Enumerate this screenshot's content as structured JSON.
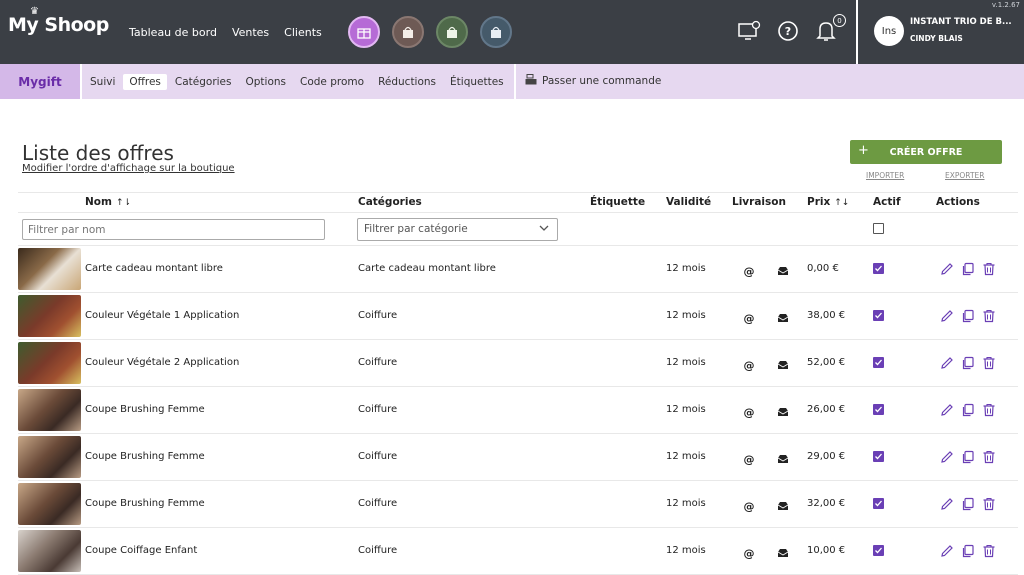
{
  "app": {
    "logo": "My Shoop",
    "version": "v.1.2.67"
  },
  "topnav": [
    {
      "label": "Tableau de bord"
    },
    {
      "label": "Ventes"
    },
    {
      "label": "Clients"
    }
  ],
  "apps": [
    {
      "name": "gift-app-icon",
      "color": "#b66bd6"
    },
    {
      "name": "shop-app-icon-1",
      "color": "#6e5a55"
    },
    {
      "name": "shop-app-icon-2",
      "color": "#4f6a4a"
    },
    {
      "name": "shop-app-icon-3",
      "color": "#455a6a"
    }
  ],
  "user": {
    "avatar": "Ins",
    "shop": "INSTANT TRIO DE B...",
    "name": "CINDY BLAIS",
    "notifications": "0"
  },
  "subnav": {
    "brand": "Mygift",
    "items": [
      {
        "label": "Suivi"
      },
      {
        "label": "Offres"
      },
      {
        "label": "Catégories"
      },
      {
        "label": "Options"
      },
      {
        "label": "Code promo"
      },
      {
        "label": "Réductions"
      },
      {
        "label": "Étiquettes"
      }
    ],
    "order": "Passer une commande"
  },
  "page": {
    "title": "Liste des offres",
    "reorder_link": "Modifier l'ordre d'affichage sur la boutique",
    "create_button": "CRÉER OFFRE",
    "import": "IMPORTER",
    "export": "EXPORTER"
  },
  "table": {
    "headers": {
      "name": "Nom",
      "categories": "Catégories",
      "label": "Étiquette",
      "validity": "Validité",
      "delivery": "Livraison",
      "price": "Prix",
      "active": "Actif",
      "actions": "Actions"
    },
    "filters": {
      "name_placeholder": "Filtrer par nom",
      "category_placeholder": "Filtrer par catégorie"
    },
    "rows": [
      {
        "name": "Carte cadeau montant libre",
        "category": "Carte cadeau montant libre",
        "validity": "12 mois",
        "price": "0,00 €",
        "active": true
      },
      {
        "name": "Couleur Végétale 1 Application",
        "category": "Coiffure",
        "validity": "12 mois",
        "price": "38,00 €",
        "active": true
      },
      {
        "name": "Couleur Végétale 2 Application",
        "category": "Coiffure",
        "validity": "12 mois",
        "price": "52,00 €",
        "active": true
      },
      {
        "name": "Coupe Brushing Femme",
        "category": "Coiffure",
        "validity": "12 mois",
        "price": "26,00 €",
        "active": true
      },
      {
        "name": "Coupe Brushing Femme",
        "category": "Coiffure",
        "validity": "12 mois",
        "price": "29,00 €",
        "active": true
      },
      {
        "name": "Coupe Brushing Femme",
        "category": "Coiffure",
        "validity": "12 mois",
        "price": "32,00 €",
        "active": true
      },
      {
        "name": "Coupe Coiffage Enfant",
        "category": "Coiffure",
        "validity": "12 mois",
        "price": "10,00 €",
        "active": true
      }
    ]
  },
  "colors": {
    "accent": "#6a3fb5",
    "create_button": "#6d9a42",
    "topbar": "#3b3f45",
    "subbar": "#e6d8f0"
  }
}
